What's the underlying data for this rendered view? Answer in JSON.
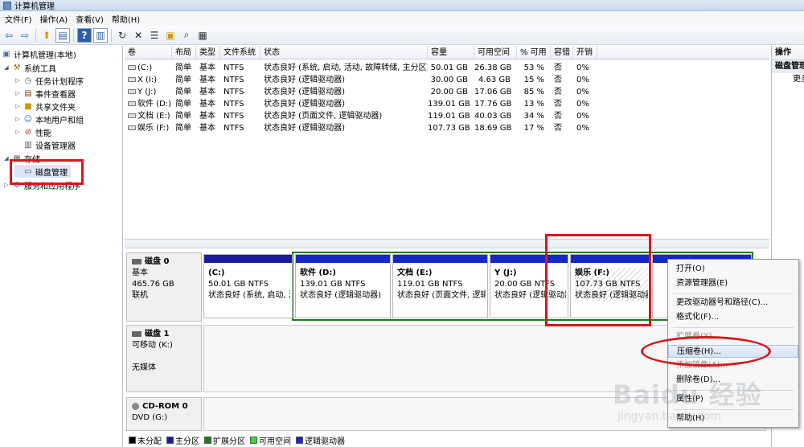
{
  "window": {
    "title": "计算机管理"
  },
  "menu": [
    "文件(F)",
    "操作(A)",
    "查看(V)",
    "帮助(H)"
  ],
  "toolbar_icons": [
    "back-icon",
    "forward-icon",
    "up-icon",
    "show-hide-tree-icon",
    "help-icon",
    "properties-pane-icon",
    "refresh-icon",
    "delete-icon",
    "properties-icon",
    "open-icon",
    "search-icon",
    "disk-icon"
  ],
  "tree": [
    {
      "label": "计算机管理(本地)",
      "icon": "computer-management-icon",
      "expanded": true,
      "selected": false
    },
    {
      "label": "系统工具",
      "icon": "tools-icon",
      "expanded": true,
      "selected": false
    },
    {
      "label": "任务计划程序",
      "icon": "clock-icon",
      "expanded": false,
      "selected": false
    },
    {
      "label": "事件查看器",
      "icon": "event-viewer-icon",
      "expanded": false,
      "selected": false
    },
    {
      "label": "共享文件夹",
      "icon": "folder-icon",
      "expanded": false,
      "selected": false
    },
    {
      "label": "本地用户和组",
      "icon": "users-icon",
      "expanded": false,
      "selected": false
    },
    {
      "label": "性能",
      "icon": "performance-icon",
      "expanded": false,
      "selected": false
    },
    {
      "label": "设备管理器",
      "icon": "device-manager-icon",
      "expanded": false,
      "selected": false
    },
    {
      "label": "存储",
      "icon": "storage-icon",
      "expanded": true,
      "selected": false
    },
    {
      "label": "磁盘管理",
      "icon": "disk-management-icon",
      "expanded": false,
      "selected": true
    },
    {
      "label": "服务和应用程序",
      "icon": "services-icon",
      "expanded": false,
      "selected": false
    }
  ],
  "volume_table": {
    "headers": [
      "卷",
      "布局",
      "类型",
      "文件系统",
      "状态",
      "容量",
      "可用空间",
      "% 可用",
      "容错",
      "开销"
    ],
    "rows": [
      [
        "(C:)",
        "简单",
        "基本",
        "NTFS",
        "状态良好 (系统, 启动, 活动, 故障转储, 主分区)",
        "50.01 GB",
        "26.38 GB",
        "53 %",
        "否",
        "0%"
      ],
      [
        "X (I:)",
        "简单",
        "基本",
        "NTFS",
        "状态良好 (逻辑驱动器)",
        "30.00 GB",
        "4.63 GB",
        "15 %",
        "否",
        "0%"
      ],
      [
        "Y (J:)",
        "简单",
        "基本",
        "NTFS",
        "状态良好 (逻辑驱动器)",
        "20.00 GB",
        "17.06 GB",
        "85 %",
        "否",
        "0%"
      ],
      [
        "软件 (D:)",
        "简单",
        "基本",
        "NTFS",
        "状态良好 (逻辑驱动器)",
        "139.01 GB",
        "17.76 GB",
        "13 %",
        "否",
        "0%"
      ],
      [
        "文档 (E:)",
        "简单",
        "基本",
        "NTFS",
        "状态良好 (页面文件, 逻辑驱动器)",
        "119.01 GB",
        "40.03 GB",
        "34 %",
        "否",
        "0%"
      ],
      [
        "娱乐 (F:)",
        "简单",
        "基本",
        "NTFS",
        "状态良好 (逻辑驱动器)",
        "107.73 GB",
        "18.69 GB",
        "17 %",
        "否",
        "0%"
      ]
    ]
  },
  "disks": [
    {
      "name": "磁盘 0",
      "lines": [
        "基本",
        "465.76 GB",
        "联机"
      ],
      "partitions": [
        {
          "name": "(C:)",
          "size": "50.01 GB NTFS",
          "status": "状态良好 (系统, 启动, 活",
          "color": "#1a1aa0"
        },
        {
          "name": "软件 (D:)",
          "size": "139.01 GB NTFS",
          "status": "状态良好 (逻辑驱动器)",
          "color": "#1427c8"
        },
        {
          "name": "文档 (E:)",
          "size": "119.01 GB NTFS",
          "status": "状态良好 (页面文件, 逻辑",
          "color": "#1427c8"
        },
        {
          "name": "Y (J:)",
          "size": "20.00 GB NTFS",
          "status": "状态良好 (逻辑驱动器)",
          "color": "#1427c8"
        },
        {
          "name": "娱乐 (F:)",
          "size": "107.73 GB NTFS",
          "status": "状态良好 (逻辑驱动器)",
          "color": "#1427c8"
        }
      ]
    },
    {
      "name": "磁盘 1",
      "lines": [
        "可移动 (K:)",
        "",
        "无媒体"
      ]
    },
    {
      "name": "CD-ROM 0",
      "lines": [
        "DVD (G:)"
      ]
    }
  ],
  "legend": [
    {
      "label": "未分配",
      "color": "#000000"
    },
    {
      "label": "主分区",
      "color": "#1a1aa0"
    },
    {
      "label": "扩展分区",
      "color": "#1c7a1c"
    },
    {
      "label": "可用空间",
      "color": "#33dd33"
    },
    {
      "label": "逻辑驱动器",
      "color": "#1427c8"
    }
  ],
  "actions_pane": {
    "header": "操作",
    "section": "磁盘管理",
    "more": "更多"
  },
  "context_menu": [
    {
      "label": "打开(O)",
      "enabled": true
    },
    {
      "label": "资源管理器(E)",
      "enabled": true
    },
    {
      "label": "更改驱动器号和路径(C)...",
      "enabled": true
    },
    {
      "label": "格式化(F)...",
      "enabled": true
    },
    {
      "label": "扩展卷(X)...",
      "enabled": false
    },
    {
      "label": "压缩卷(H)...",
      "enabled": true,
      "highlighted": true
    },
    {
      "label": "添加镜像(A)...",
      "enabled": false
    },
    {
      "label": "删除卷(D)...",
      "enabled": true
    },
    {
      "label": "属性(P)",
      "enabled": true
    },
    {
      "label": "帮助(H)",
      "enabled": true
    }
  ],
  "watermark": {
    "brand": "Baidu 经验",
    "url": "jingyan.baidu.com"
  },
  "colors": {
    "annotation_red": "#d9161c",
    "primary_partition": "#1a1aa0",
    "logical_drive": "#1427c8",
    "extended_partition_border": "#1c7a1c"
  }
}
